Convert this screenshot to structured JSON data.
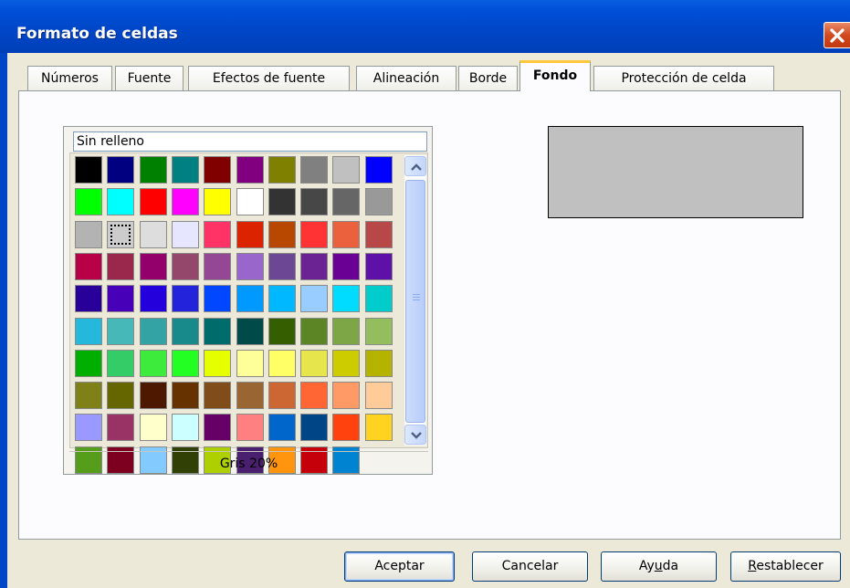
{
  "window": {
    "title": "Formato de celdas",
    "close_icon": "close-icon"
  },
  "tabs": [
    {
      "label": "Números",
      "active": false
    },
    {
      "label": "Fuente",
      "active": false
    },
    {
      "label": "Efectos de fuente",
      "active": false
    },
    {
      "label": "Alineación",
      "active": false
    },
    {
      "label": "Borde",
      "active": false
    },
    {
      "label": "Fondo",
      "active": true
    },
    {
      "label": "Protección de celda",
      "active": false
    }
  ],
  "background": {
    "fill_option": "Sin relleno",
    "selected_color_name": "Gris 20%",
    "selected_color": "#c0c0c0",
    "palette": [
      [
        "#000000",
        "#000080",
        "#008000",
        "#008080",
        "#800000",
        "#800080",
        "#808000",
        "#808080",
        "#c0c0c0",
        "#0000ff"
      ],
      [
        "#00ff00",
        "#00ffff",
        "#ff0000",
        "#ff00ff",
        "#ffff00",
        "#ffffff",
        "#333333",
        "#474747",
        "#666666",
        "#999999"
      ],
      [
        "#b3b3b3",
        "#cccccc",
        "#dddddd",
        "#e6e6ff",
        "#ff3366",
        "#dc2300",
        "#b84700",
        "#ff3333",
        "#eb613d",
        "#b84747"
      ],
      [
        "#b80047",
        "#99284c",
        "#94006b",
        "#94476b",
        "#944794",
        "#9966cc",
        "#6b4794",
        "#6b2394",
        "#6b0094",
        "#5e11a6"
      ],
      [
        "#280099",
        "#4700b8",
        "#2300dc",
        "#2323dc",
        "#0047ff",
        "#0099ff",
        "#00b8ff",
        "#99ccff",
        "#00dcff",
        "#00cccc"
      ],
      [
        "#23b8dc",
        "#47b8b8",
        "#33a3a3",
        "#198a8a",
        "#006b6b",
        "#004a4a",
        "#355e00",
        "#5c8526",
        "#7da647",
        "#94bd5e"
      ],
      [
        "#00ae00",
        "#33cc66",
        "#3deb3d",
        "#23ff23",
        "#e6ff00",
        "#ffff99",
        "#ffff66",
        "#e6e64c",
        "#cccc00",
        "#b3b300"
      ],
      [
        "#808019",
        "#666600",
        "#4c1900",
        "#663300",
        "#804c19",
        "#996633",
        "#cc6633",
        "#ff6633",
        "#ff9966",
        "#ffcc99"
      ],
      [
        "#9999ff",
        "#993366",
        "#ffffcc",
        "#ccffff",
        "#660066",
        "#ff8080",
        "#0066cc",
        "#004586",
        "#ff420e",
        "#ffd320"
      ],
      [
        "#579d1c",
        "#7e0021",
        "#83caff",
        "#314004",
        "#aecf00",
        "#4b1f6f",
        "#ff950e",
        "#c5000b",
        "#0084d1"
      ]
    ],
    "selected_index": {
      "row": 2,
      "col": 1
    }
  },
  "scrollbar": {
    "up_icon": "chevron-up-icon",
    "down_icon": "chevron-down-icon"
  },
  "buttons": {
    "ok": "Aceptar",
    "cancel": "Cancelar",
    "help_pre": "Ay",
    "help_mn": "u",
    "help_post": "da",
    "reset_mn": "R",
    "reset_post": "establecer"
  }
}
